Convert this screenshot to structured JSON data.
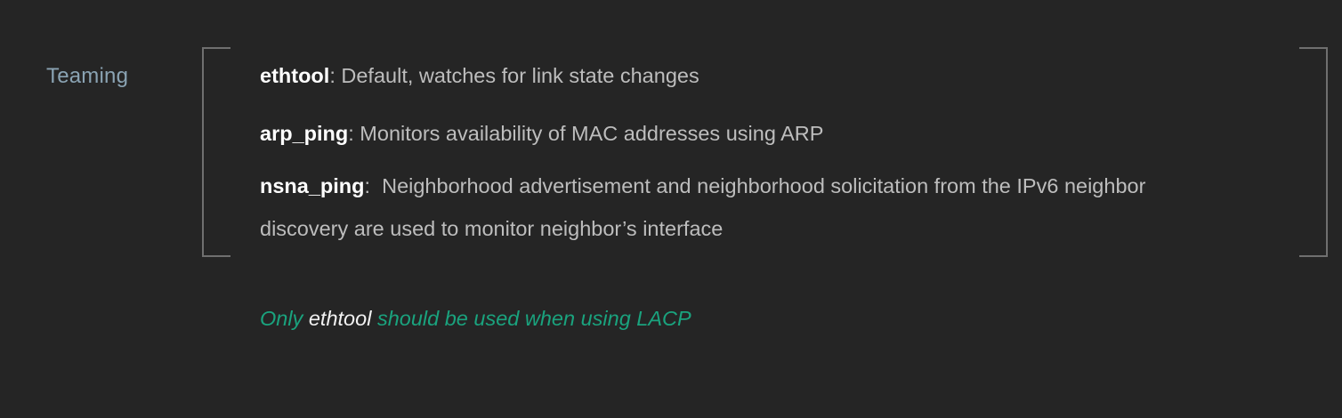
{
  "section": {
    "label": "Teaming"
  },
  "items": [
    {
      "term": "ethtool",
      "separator": ":",
      "description": " Default, watches for link state changes"
    },
    {
      "term": "arp_ping",
      "separator": ":",
      "description": " Monitors availability of MAC addresses using ARP"
    },
    {
      "term": "nsna_ping",
      "separator": ":",
      "description_line1": "  Neighborhood advertisement and neighborhood solicitation from the IPv6 neighbor",
      "description_line2": "discovery are used to monitor neighbor’s interface"
    }
  ],
  "note": {
    "prefix": "Only ",
    "term": "ethtool",
    "suffix": " should be used when using LACP"
  },
  "colors": {
    "background": "#252525",
    "label": "#8aa3b3",
    "term": "#ffffff",
    "text": "#bdbdbd",
    "accent": "#1aa37e",
    "bracket": "#6f6f6f"
  }
}
